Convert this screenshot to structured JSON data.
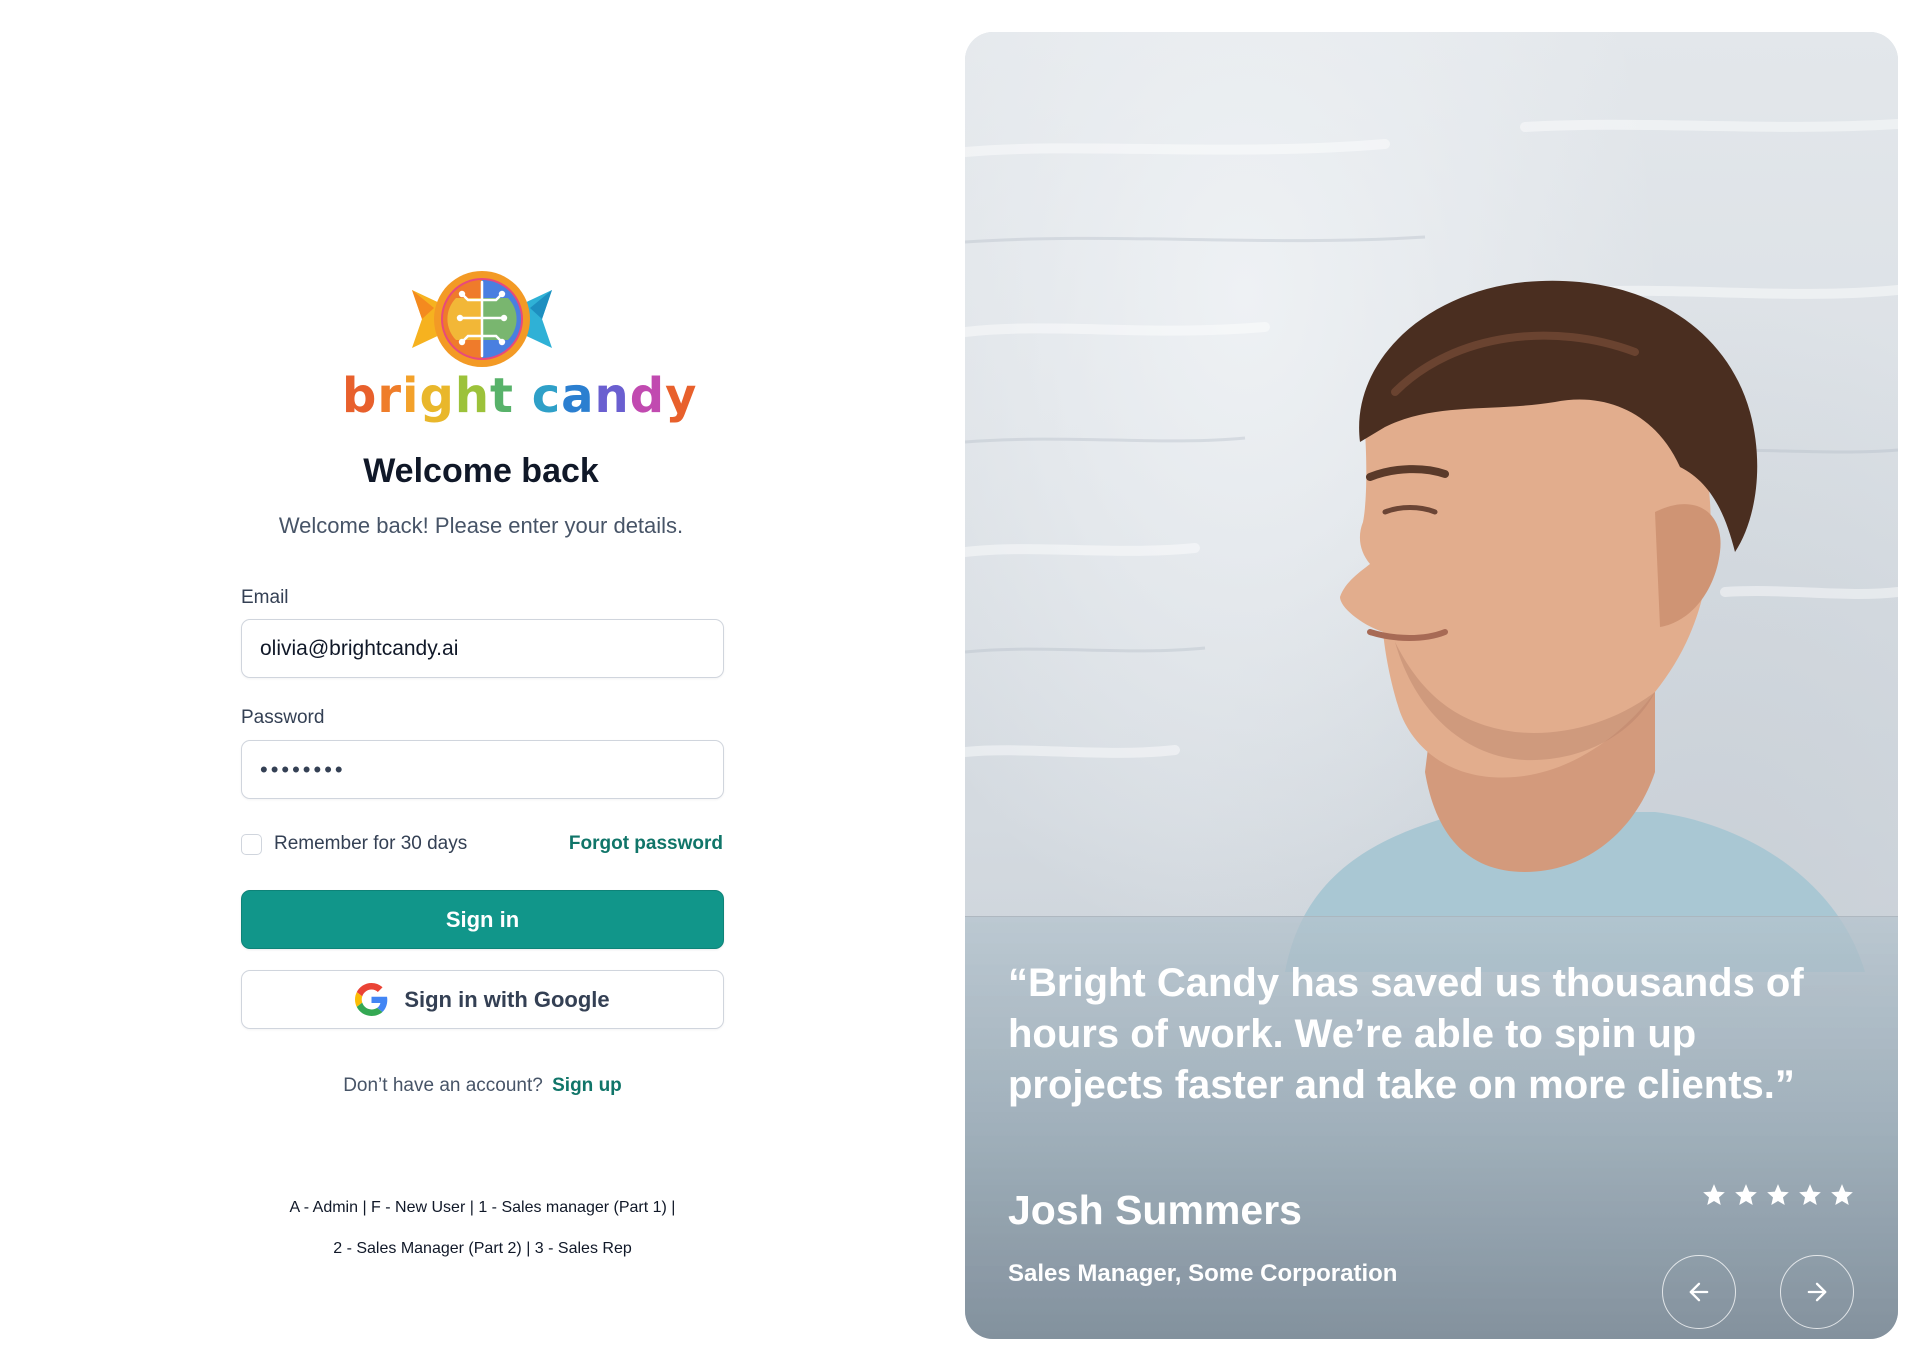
{
  "brand": {
    "word": [
      {
        "ch": "b",
        "color": "#e8602c"
      },
      {
        "ch": "r",
        "color": "#ef7d2a"
      },
      {
        "ch": "i",
        "color": "#f3a12a"
      },
      {
        "ch": "g",
        "color": "#e9b72b"
      },
      {
        "ch": "h",
        "color": "#9cc23a"
      },
      {
        "ch": "t",
        "color": "#58b26a"
      },
      {
        "ch": " ",
        "color": "#000000"
      },
      {
        "ch": "c",
        "color": "#2fa0c8"
      },
      {
        "ch": "a",
        "color": "#2b7fd0"
      },
      {
        "ch": "n",
        "color": "#6a5fd0"
      },
      {
        "ch": "d",
        "color": "#c14ab0"
      },
      {
        "ch": "y",
        "color": "#e8602c"
      }
    ]
  },
  "login": {
    "title": "Welcome back",
    "subtitle": "Welcome back! Please enter your details.",
    "email_label": "Email",
    "email_value": "olivia@brightcandy.ai",
    "password_label": "Password",
    "password_value": "••••••••",
    "remember_label": "Remember for 30 days",
    "forgot_label": "Forgot password",
    "signin_label": "Sign in",
    "google_label": "Sign in with Google",
    "no_account_text": "Don’t have an account?",
    "signup_label": "Sign up",
    "shortcuts_line1": "A - Admin | F - New User | 1 - Sales manager (Part 1) |",
    "shortcuts_line2": "2 - Sales Manager (Part 2) | 3 - Sales Rep"
  },
  "testimonial": {
    "quote": "“Bright Candy has saved us thousands of hours of work. We’re able to spin up projects faster and take on more clients.”",
    "author": "Josh Summers",
    "role": "Sales Manager, Some Corporation",
    "rating": 5,
    "prev_icon": "arrow-left-icon",
    "next_icon": "arrow-right-icon"
  },
  "colors": {
    "primary": "#11968a",
    "link": "#107569",
    "text": "#101828",
    "muted": "#475467"
  }
}
